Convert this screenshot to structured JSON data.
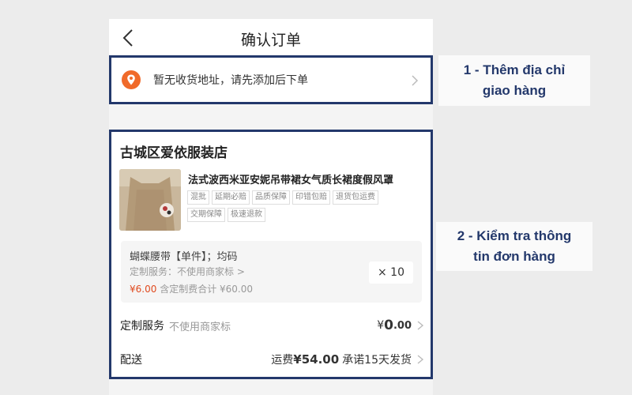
{
  "header": {
    "title": "确认订单"
  },
  "address": {
    "placeholder_text": "暂无收货地址，请先添加后下单"
  },
  "order": {
    "shop_name": "古城区爱依服装店",
    "product_title": "法式波西米亚安妮吊带裙女气质长裙度假风罩",
    "tags": [
      "混批",
      "延期必赔",
      "品质保障",
      "印错包赔",
      "退货包运费",
      "交期保障",
      "极速退款"
    ],
    "variant": {
      "name": "蝴蝶腰带【单件】；均码",
      "custom_service": "定制服务：不使用商家标 >",
      "unit_price": "¥6.00",
      "price_note": "含定制费合计 ¥60.00",
      "quantity": "× 10"
    },
    "custom_row": {
      "label": "定制服务",
      "value_text": "不使用商家标",
      "price_symbol": "¥",
      "price_int": "0",
      "price_dec": ".00"
    },
    "shipping_row": {
      "label": "配送",
      "fee_label": "运费",
      "fee_value": "¥54.00",
      "promise": "承诺15天发货"
    }
  },
  "callouts": {
    "step1_line1": "1 - Thêm địa chỉ",
    "step1_line2": "giao hàng",
    "step2_line1": "2 - Kiểm tra thông",
    "step2_line2": "tin đơn hàng"
  },
  "colors": {
    "border": "#23386b",
    "accent": "#e04a1f",
    "pin": "#f06a2a"
  }
}
